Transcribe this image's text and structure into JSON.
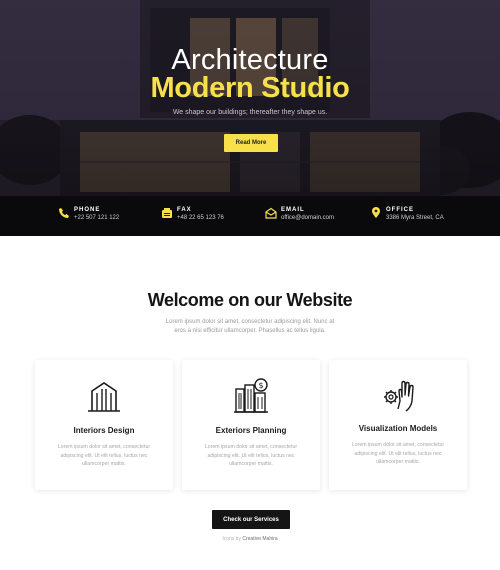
{
  "hero": {
    "title_line1": "Architecture",
    "title_line2": "Modern Studio",
    "subtitle": "We shape our buildings; thereafter they shape us.",
    "button_label": "Read More",
    "accent_color": "#f7e04a"
  },
  "contact": [
    {
      "icon": "phone-icon",
      "label": "PHONE",
      "value": "+22 507 121 122"
    },
    {
      "icon": "fax-icon",
      "label": "FAX",
      "value": "+48 22 65 123 76"
    },
    {
      "icon": "email-icon",
      "label": "EMAIL",
      "value": "office@domain.com"
    },
    {
      "icon": "location-pin-icon",
      "label": "OFFICE",
      "value": "3386 Myra Street, CA"
    }
  ],
  "welcome": {
    "title": "Welcome on our Website",
    "description": "Lorem ipsum dolor sit amet, consectetur adipiscing elit. Nunc at eros a nisi efficitur ullamcorper. Phasellus ac tellus ligula."
  },
  "cards": [
    {
      "icon": "building-icon",
      "title": "Interiors Design",
      "description": "Lorem ipsum dolor sit amet, consectetur adipiscing elit. Ut elit tellus, luctus nec ullamcorper mattis."
    },
    {
      "icon": "city-money-icon",
      "title": "Exteriors Planning",
      "description": "Lorem ipsum dolor sit amet, consectetur adipiscing elit. Ut elit tellus, luctus nec ullamcorper mattis."
    },
    {
      "icon": "hand-gear-icon",
      "title": "Visualization Models",
      "description": "Lorem ipsum dolor sit amet, consectetur adipiscing elit. Ut elit tellus, luctus nec ullamcorper mattis."
    }
  ],
  "cta": {
    "button_label": "Check our Services",
    "credit_prefix": "Icons by",
    "credit_name": "Creative Mahira"
  }
}
